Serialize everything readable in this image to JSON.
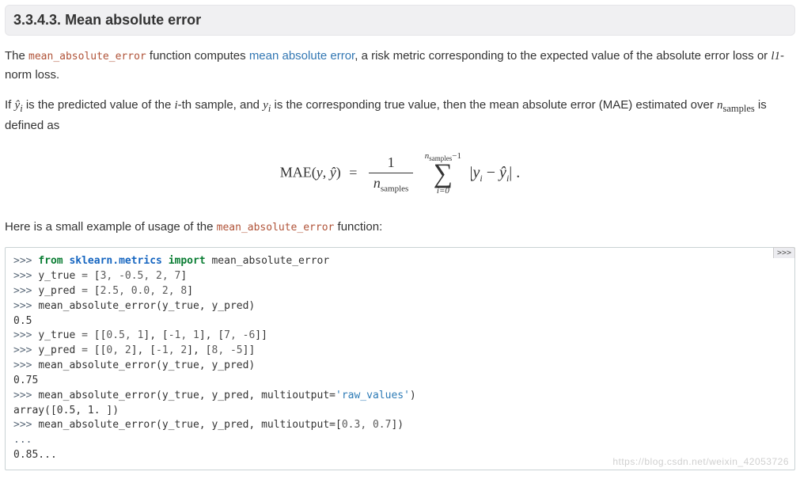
{
  "heading": {
    "number": "3.3.4.3.",
    "title": "Mean absolute error"
  },
  "intro": {
    "t1": "The ",
    "fn": "mean_absolute_error",
    "t2": " function computes ",
    "link": "mean absolute error",
    "t3": ", a risk metric corresponding to the expected value of the absolute error loss or ",
    "l1norm": "l1",
    "t4": "-norm loss."
  },
  "def_sentence": {
    "d1": "If ",
    "yhat_i": "ŷ",
    "d2": " is the predicted value of the ",
    "ith": "i",
    "d3": "-th sample, and ",
    "y_i": "y",
    "d4": " is the corresponding true value, then the mean absolute error (MAE) estimated over ",
    "nsamples_var": "n",
    "nsamples_sub": "samples",
    "d5": " is defined as"
  },
  "equation": {
    "lhs_fn": "MAE",
    "lhs_args_y": "y",
    "lhs_args_yhat": "ŷ",
    "eq": "=",
    "frac_num": "1",
    "frac_den_n": "n",
    "frac_den_sub": "samples",
    "sum_top_n": "n",
    "sum_top_sub": "samples",
    "sum_top_minus1": "−1",
    "sigma": "∑",
    "sum_bot_i0": "i=0",
    "abs_open": "|",
    "term_y": "y",
    "term_sub": "i",
    "minus": " − ",
    "term_yhat": "ŷ",
    "abs_close": "|",
    "period": " ."
  },
  "example_intro": {
    "e1": "Here is a small example of usage of the ",
    "fn": "mean_absolute_error",
    "e2": " function:"
  },
  "code_toggle": ">>>",
  "code": [
    {
      "t": "prompt",
      "v": ">>> "
    },
    {
      "t": "kw",
      "v": "from"
    },
    {
      "t": "sp",
      "v": " "
    },
    {
      "t": "mod",
      "v": "sklearn.metrics"
    },
    {
      "t": "sp",
      "v": " "
    },
    {
      "t": "kw",
      "v": "import"
    },
    {
      "t": "sp",
      "v": " "
    },
    {
      "t": "name",
      "v": "mean_absolute_error"
    },
    {
      "t": "nl"
    },
    {
      "t": "prompt",
      "v": ">>> "
    },
    {
      "t": "name",
      "v": "y_true "
    },
    {
      "t": "op",
      "v": "="
    },
    {
      "t": "name",
      "v": " ["
    },
    {
      "t": "num",
      "v": "3"
    },
    {
      "t": "op",
      "v": ", "
    },
    {
      "t": "num",
      "v": "-0.5"
    },
    {
      "t": "op",
      "v": ", "
    },
    {
      "t": "num",
      "v": "2"
    },
    {
      "t": "op",
      "v": ", "
    },
    {
      "t": "num",
      "v": "7"
    },
    {
      "t": "name",
      "v": "]"
    },
    {
      "t": "nl"
    },
    {
      "t": "prompt",
      "v": ">>> "
    },
    {
      "t": "name",
      "v": "y_pred "
    },
    {
      "t": "op",
      "v": "="
    },
    {
      "t": "name",
      "v": " ["
    },
    {
      "t": "num",
      "v": "2.5"
    },
    {
      "t": "op",
      "v": ", "
    },
    {
      "t": "num",
      "v": "0.0"
    },
    {
      "t": "op",
      "v": ", "
    },
    {
      "t": "num",
      "v": "2"
    },
    {
      "t": "op",
      "v": ", "
    },
    {
      "t": "num",
      "v": "8"
    },
    {
      "t": "name",
      "v": "]"
    },
    {
      "t": "nl"
    },
    {
      "t": "prompt",
      "v": ">>> "
    },
    {
      "t": "name",
      "v": "mean_absolute_error(y_true, y_pred)"
    },
    {
      "t": "nl"
    },
    {
      "t": "out",
      "v": "0.5"
    },
    {
      "t": "nl"
    },
    {
      "t": "prompt",
      "v": ">>> "
    },
    {
      "t": "name",
      "v": "y_true "
    },
    {
      "t": "op",
      "v": "="
    },
    {
      "t": "name",
      "v": " [["
    },
    {
      "t": "num",
      "v": "0.5"
    },
    {
      "t": "op",
      "v": ", "
    },
    {
      "t": "num",
      "v": "1"
    },
    {
      "t": "name",
      "v": "], ["
    },
    {
      "t": "num",
      "v": "-1"
    },
    {
      "t": "op",
      "v": ", "
    },
    {
      "t": "num",
      "v": "1"
    },
    {
      "t": "name",
      "v": "], ["
    },
    {
      "t": "num",
      "v": "7"
    },
    {
      "t": "op",
      "v": ", "
    },
    {
      "t": "num",
      "v": "-6"
    },
    {
      "t": "name",
      "v": "]]"
    },
    {
      "t": "nl"
    },
    {
      "t": "prompt",
      "v": ">>> "
    },
    {
      "t": "name",
      "v": "y_pred "
    },
    {
      "t": "op",
      "v": "="
    },
    {
      "t": "name",
      "v": " [["
    },
    {
      "t": "num",
      "v": "0"
    },
    {
      "t": "op",
      "v": ", "
    },
    {
      "t": "num",
      "v": "2"
    },
    {
      "t": "name",
      "v": "], ["
    },
    {
      "t": "num",
      "v": "-1"
    },
    {
      "t": "op",
      "v": ", "
    },
    {
      "t": "num",
      "v": "2"
    },
    {
      "t": "name",
      "v": "], ["
    },
    {
      "t": "num",
      "v": "8"
    },
    {
      "t": "op",
      "v": ", "
    },
    {
      "t": "num",
      "v": "-5"
    },
    {
      "t": "name",
      "v": "]]"
    },
    {
      "t": "nl"
    },
    {
      "t": "prompt",
      "v": ">>> "
    },
    {
      "t": "name",
      "v": "mean_absolute_error(y_true, y_pred)"
    },
    {
      "t": "nl"
    },
    {
      "t": "out",
      "v": "0.75"
    },
    {
      "t": "nl"
    },
    {
      "t": "prompt",
      "v": ">>> "
    },
    {
      "t": "name",
      "v": "mean_absolute_error(y_true, y_pred, multioutput="
    },
    {
      "t": "str",
      "v": "'raw_values'"
    },
    {
      "t": "name",
      "v": ")"
    },
    {
      "t": "nl"
    },
    {
      "t": "out",
      "v": "array([0.5, 1. ])"
    },
    {
      "t": "nl"
    },
    {
      "t": "prompt",
      "v": ">>> "
    },
    {
      "t": "name",
      "v": "mean_absolute_error(y_true, y_pred, multioutput=["
    },
    {
      "t": "num",
      "v": "0.3"
    },
    {
      "t": "op",
      "v": ", "
    },
    {
      "t": "num",
      "v": "0.7"
    },
    {
      "t": "name",
      "v": "])"
    },
    {
      "t": "nl"
    },
    {
      "t": "prompt",
      "v": "... "
    },
    {
      "t": "nl"
    },
    {
      "t": "out",
      "v": "0.85..."
    }
  ],
  "watermark": "https://blog.csdn.net/weixin_42053726"
}
